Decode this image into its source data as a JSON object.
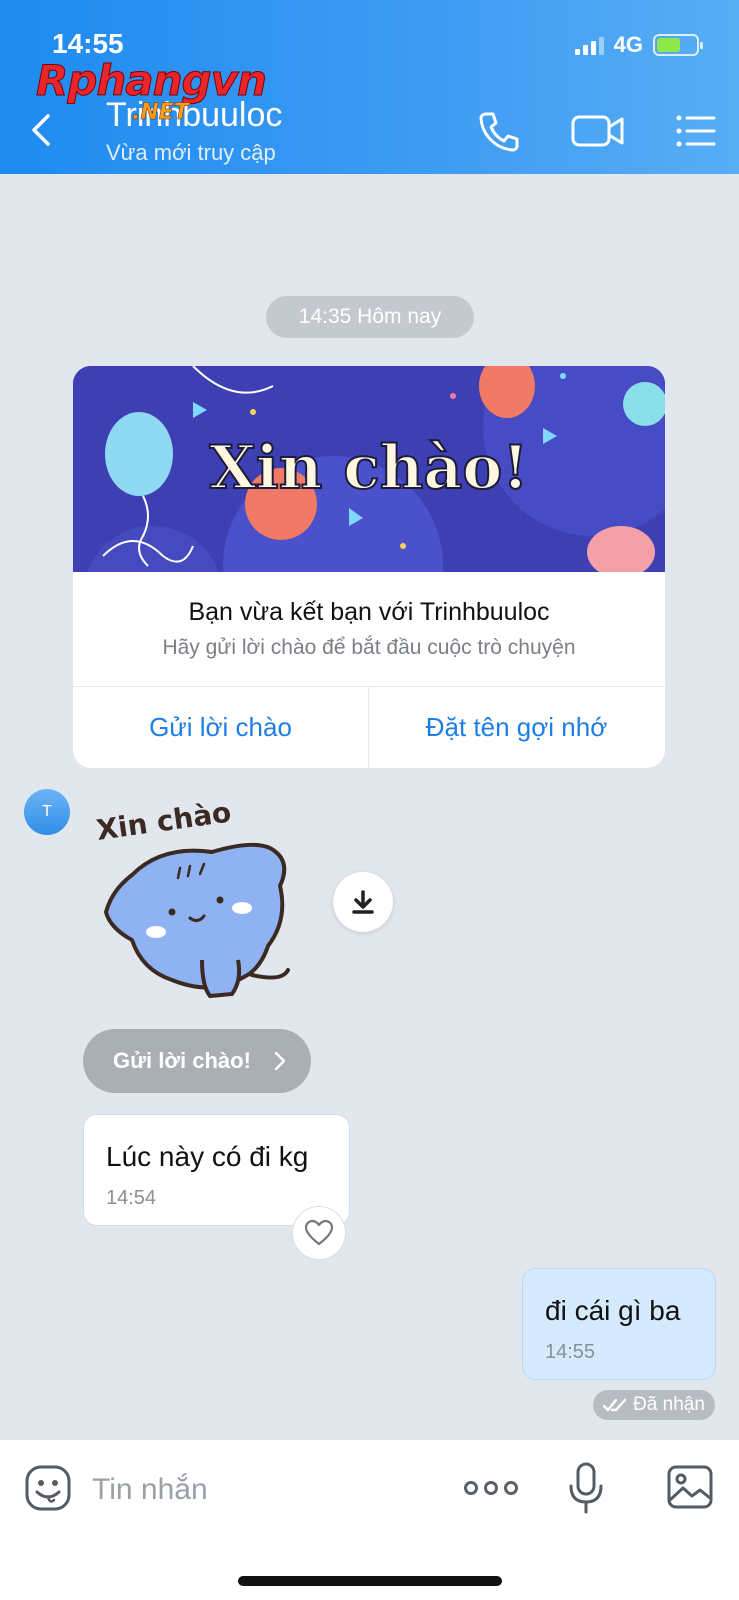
{
  "status_bar": {
    "time": "14:55",
    "network": "4G"
  },
  "watermark": {
    "main": "Rphangvn",
    "sub": ".NET"
  },
  "header": {
    "contact_name": "Trinhbuuloc",
    "contact_status": "Vừa mới truy cập",
    "icons": [
      "back-icon",
      "phone-icon",
      "video-icon",
      "menu-icon"
    ]
  },
  "chat": {
    "date_label": "14:35 Hôm nay",
    "greeting_card": {
      "banner_text": "Xin chào!",
      "title": "Bạn vừa kết bạn với Trinhbuuloc",
      "subtitle": "Hãy gửi lời chào để bắt đầu cuộc trò chuyện",
      "button_left": "Gửi lời chào",
      "button_right": "Đặt tên gợi nhớ"
    },
    "avatar_initial": "T",
    "sticker_text": "Xin chào",
    "greeting_pill": "Gửi lời chào!",
    "messages": [
      {
        "direction": "in",
        "text": "Lúc này có đi kg",
        "time": "14:54"
      },
      {
        "direction": "out",
        "text": "đi cái gì ba",
        "time": "14:55"
      }
    ],
    "receipt": "Đã nhận"
  },
  "input_bar": {
    "placeholder": "Tin nhắn"
  },
  "colors": {
    "header": "#3f9cf3",
    "chat_bg": "#e2e7ee",
    "accent": "#1f7ee6",
    "out_bubble": "#d5ebfd"
  }
}
